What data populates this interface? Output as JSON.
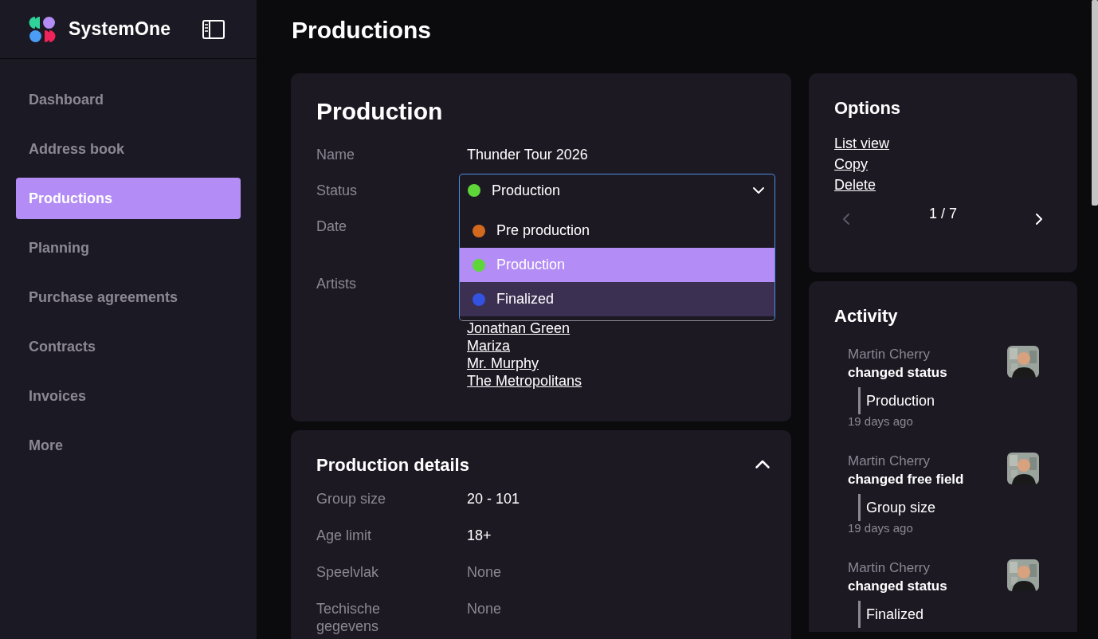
{
  "sidebar": {
    "brand": "SystemOne",
    "items": [
      {
        "label": "Dashboard",
        "selected": false
      },
      {
        "label": "Address book",
        "selected": false
      },
      {
        "label": "Productions",
        "selected": true
      },
      {
        "label": "Planning",
        "selected": false
      },
      {
        "label": "Purchase agreements",
        "selected": false
      },
      {
        "label": "Contracts",
        "selected": false
      },
      {
        "label": "Invoices",
        "selected": false
      },
      {
        "label": "More",
        "selected": false
      }
    ]
  },
  "page_title": "Productions",
  "production": {
    "title": "Production",
    "name_label": "Name",
    "name_value": "Thunder Tour 2026",
    "status_label": "Status",
    "status": {
      "value": "Production",
      "color": "#5ed63a",
      "expanded": true,
      "options": [
        {
          "label": "Pre production",
          "color": "#d2691e",
          "selected": false,
          "hovered": false
        },
        {
          "label": "Production",
          "color": "#5ed63a",
          "selected": true,
          "hovered": false
        },
        {
          "label": "Finalized",
          "color": "#3352e0",
          "selected": false,
          "hovered": true
        }
      ]
    },
    "date_label": "Date",
    "artists_label": "Artists",
    "artists": [
      "Jonathan Green",
      "Mariza",
      "Mr. Murphy",
      "The Metropolitans"
    ]
  },
  "details": {
    "title": "Production details",
    "expanded": true,
    "rows": [
      {
        "label": "Group size",
        "value": "20 - 101",
        "empty": false
      },
      {
        "label": "Age limit",
        "value": "18+",
        "empty": false
      },
      {
        "label": "Speelvlak",
        "value": "None",
        "empty": true
      },
      {
        "label": "Techische gegevens",
        "value": "None",
        "empty": true
      }
    ]
  },
  "options": {
    "title": "Options",
    "links": [
      "List view",
      "Copy",
      "Delete"
    ],
    "pager": "1 / 7",
    "prev_disabled": true,
    "next_disabled": false
  },
  "activity": {
    "title": "Activity",
    "items": [
      {
        "user": "Martin Cherry",
        "action": "changed status",
        "value": "Production",
        "time": "19 days ago"
      },
      {
        "user": "Martin Cherry",
        "action": "changed free field",
        "value": "Group size",
        "time": "19 days ago"
      },
      {
        "user": "Martin Cherry",
        "action": "changed status",
        "value": "Finalized"
      }
    ]
  }
}
